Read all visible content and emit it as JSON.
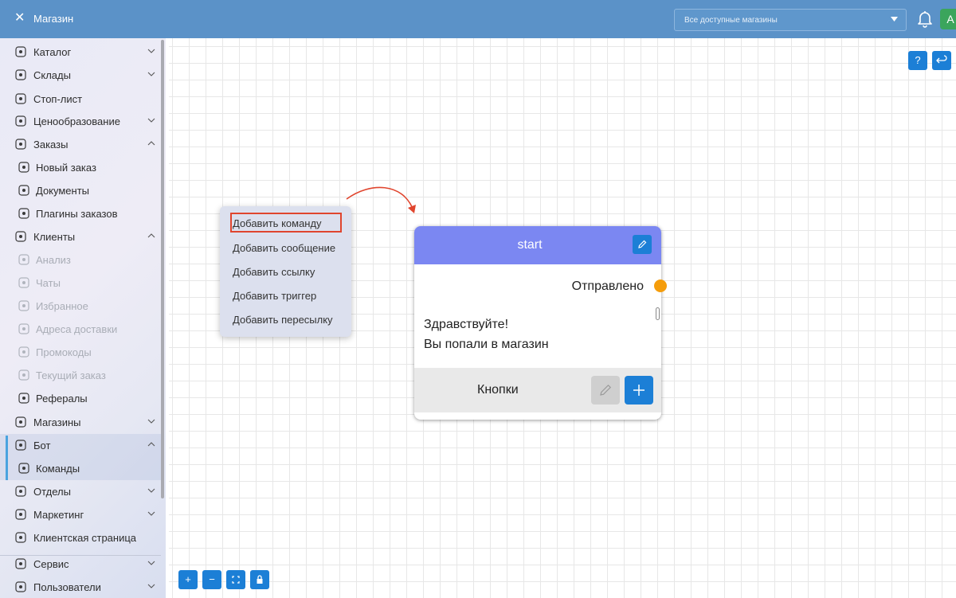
{
  "topbar": {
    "title": "Магазин",
    "store_select": {
      "value": "Все доступные магазины"
    },
    "avatar_letter": "A"
  },
  "sidebar": {
    "items": [
      {
        "label": "Каталог",
        "icon": "catalog-icon",
        "chevron": "down"
      },
      {
        "label": "Склады",
        "icon": "warehouse-icon",
        "chevron": "down"
      },
      {
        "label": "Стоп-лист",
        "icon": "hand-stop-icon"
      },
      {
        "label": "Ценообразование",
        "icon": "price-tag-icon",
        "chevron": "down"
      },
      {
        "label": "Заказы",
        "icon": "orders-icon",
        "chevron": "up"
      },
      {
        "label": "Новый заказ",
        "icon": "new-order-icon"
      },
      {
        "label": "Документы",
        "icon": "documents-icon"
      },
      {
        "label": "Плагины заказов",
        "icon": "plugin-icon"
      },
      {
        "label": "Клиенты",
        "icon": "clients-icon",
        "chevron": "up"
      },
      {
        "label": "Анализ",
        "icon": "analysis-icon"
      },
      {
        "label": "Чаты",
        "icon": "chat-icon"
      },
      {
        "label": "Избранное",
        "icon": "heart-icon"
      },
      {
        "label": "Адреса доставки",
        "icon": "location-icon"
      },
      {
        "label": "Промокоды",
        "icon": "gift-icon"
      },
      {
        "label": "Текущий заказ",
        "icon": "bag-icon"
      },
      {
        "label": "Рефералы",
        "icon": "link-icon"
      },
      {
        "label": "Магазины",
        "icon": "store-icon",
        "chevron": "down"
      },
      {
        "label": "Бот",
        "icon": "bot-icon",
        "chevron": "up"
      },
      {
        "label": "Команды",
        "icon": "command-icon"
      },
      {
        "label": "Отделы",
        "icon": "departments-icon",
        "chevron": "down"
      },
      {
        "label": "Маркетинг",
        "icon": "marketing-icon",
        "chevron": "down"
      },
      {
        "label": "Клиентская страница",
        "icon": "client-page-icon"
      },
      {
        "label": "Сервис",
        "icon": "service-icon",
        "chevron": "down"
      },
      {
        "label": "Пользователи",
        "icon": "users-icon",
        "chevron": "down"
      }
    ]
  },
  "canvas": {
    "help_label": "?",
    "context_menu": {
      "items": [
        "Добавить команду",
        "Добавить сообщение",
        "Добавить ссылку",
        "Добавить триггер",
        "Добавить пересылку"
      ]
    },
    "node": {
      "title": "start",
      "status": "Отправлено",
      "message_lines": [
        "Здравствуйте!",
        "Вы попали в магазин"
      ],
      "buttons_label": "Кнопки"
    },
    "zoom_controls": {
      "plus": "+",
      "minus": "−"
    }
  },
  "colors": {
    "topbar": "#5b92c8",
    "accent": "#1c7fd6",
    "node_header": "#7b87f2",
    "port": "#f59d0b",
    "highlight": "#e0452e"
  }
}
